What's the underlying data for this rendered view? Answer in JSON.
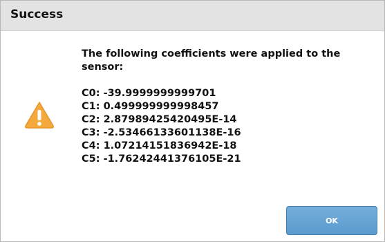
{
  "dialog": {
    "title": "Success",
    "icon": "warning-icon",
    "message_lines": [
      "The following coefficients were applied to the",
      "sensor:"
    ],
    "coefficients": [
      "C0: -39.9999999999701",
      "C1: 0.499999999998457",
      "C2: 2.87989425420495E-14",
      "C3: -2.53466133601138E-16",
      "C4: 1.07214151836942E-18",
      "C5: -1.76242441376105E-21"
    ],
    "ok_label": "OK"
  },
  "colors": {
    "titlebar_bg": "#e3e3e3",
    "warning_icon": "#f3a93c",
    "ok_button": "#6aa6d6"
  }
}
